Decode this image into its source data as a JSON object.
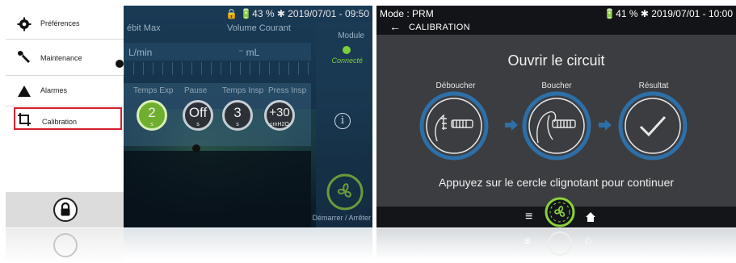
{
  "left_screen": {
    "status": {
      "text": "🔒 🔋43 % ✱ 2019/07/01 - 09:50"
    },
    "header": {
      "debit_label": "ébit Max",
      "volume_label": "Volume Courant"
    },
    "measure": {
      "unit_flow": "L/min",
      "unit_volume": "⁻ mL"
    },
    "params": {
      "labels": [
        "Temps Exp",
        "Pause",
        "Temps Insp",
        "Press Insp"
      ],
      "knobs": [
        {
          "value": "2",
          "unit": "s",
          "active": true
        },
        {
          "value": "Off",
          "unit": "s",
          "active": false
        },
        {
          "value": "3",
          "unit": "s",
          "active": false
        },
        {
          "value": "+30",
          "unit": "cmH2O",
          "active": false
        }
      ]
    },
    "module": {
      "label": "Module",
      "status": "Connecté",
      "status_color": "#7fcf3a"
    },
    "start_stop_label": "Démarrer / Arrêter",
    "drawer": {
      "items": [
        {
          "label": "Préférences",
          "icon": "gear-icon"
        },
        {
          "label": "Maintenance",
          "icon": "wrench-icon",
          "locked": true
        },
        {
          "label": "Alarmes",
          "icon": "warning-triangle-icon"
        },
        {
          "label": "Calibration",
          "icon": "crop-icon",
          "selected": true
        }
      ],
      "highlight_color": "#d61e2b"
    }
  },
  "right_screen": {
    "mode": "Mode : PRM",
    "status": "🔋41 % ✱ 2019/07/01 - 10:00",
    "back_label": "←",
    "title": "CALIBRATION",
    "instruction": "Ouvrir le circuit",
    "steps": [
      {
        "label": "Déboucher",
        "icon": "open-circuit-hand-icon"
      },
      {
        "label": "Boucher",
        "icon": "block-circuit-hand-icon"
      },
      {
        "label": "Résultat",
        "icon": "checkmark-icon"
      }
    ],
    "hint": "Appuyez sur le cercle clignotant pour continuer",
    "accent_color": "#2d6fa8",
    "fan_color": "#8cd13e",
    "bottom_menu_label": "≡"
  }
}
